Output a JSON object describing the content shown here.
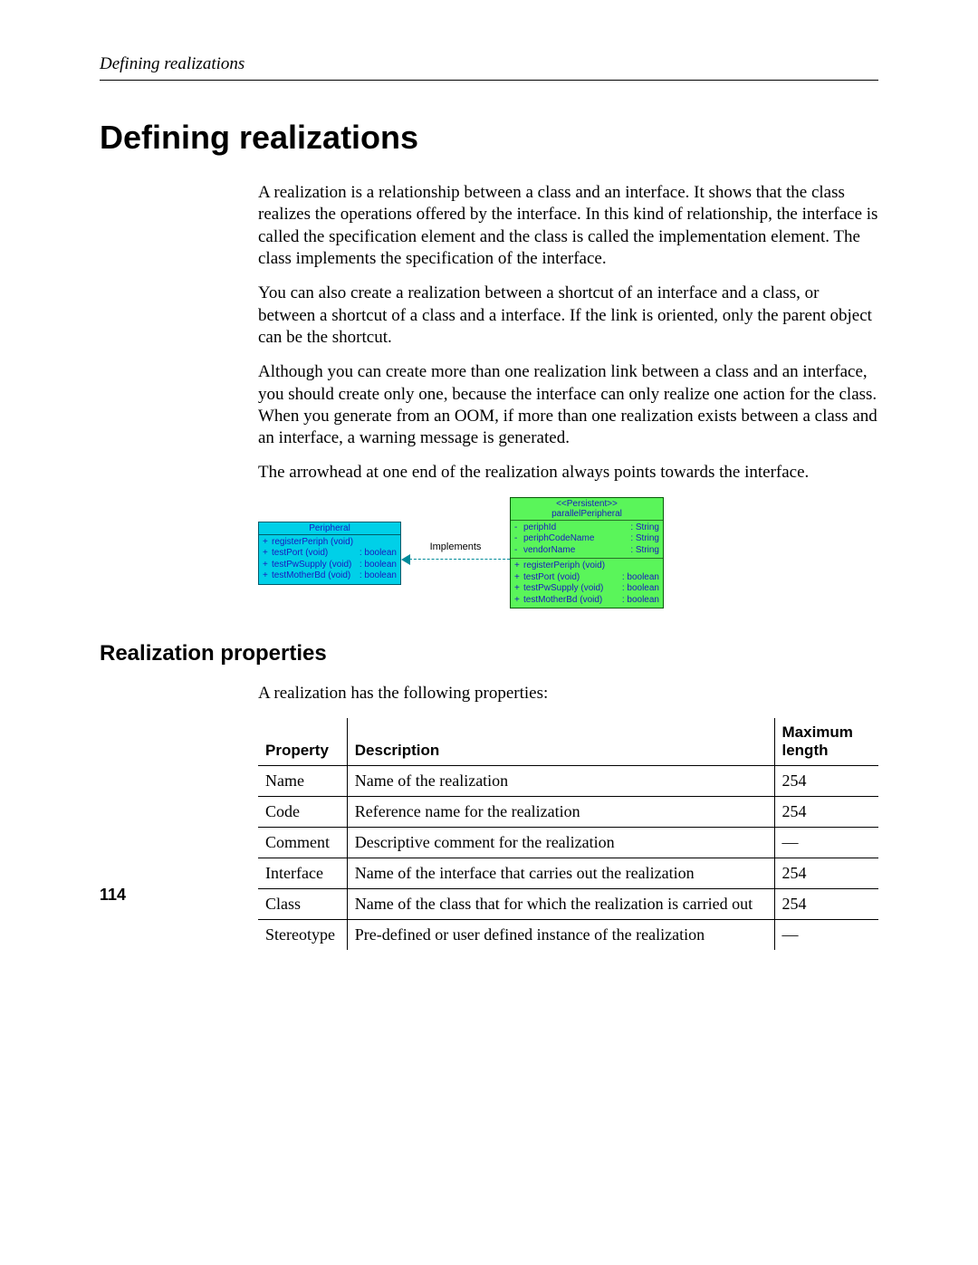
{
  "running_header": "Defining realizations",
  "title": "Defining realizations",
  "para1": "A realization is a relationship between a class and an interface. It shows that the class realizes the operations offered by the interface. In this kind of relationship, the interface is called the specification element and the class is called the implementation element. The class implements the specification of the interface.",
  "para2": "You can also create a realization between a shortcut of an interface and a class, or between a shortcut of a class and a interface. If the link is oriented, only the parent object can be the shortcut.",
  "para3": "Although you can create more than one realization link between a class and an interface, you should create only one, because the interface can only realize one action for the class. When you generate from an OOM, if more than one realization exists between a class and an interface, a warning message is generated.",
  "para4": "The arrowhead at one end of the realization always points towards the interface.",
  "uml": {
    "class_title": "Peripheral",
    "class_ops": [
      {
        "vis": "+",
        "sig": "registerPeriph (void)",
        "ret": ""
      },
      {
        "vis": "+",
        "sig": "testPort (void)",
        "ret": ": boolean"
      },
      {
        "vis": "+",
        "sig": "testPwSupply (void)",
        "ret": ": boolean"
      },
      {
        "vis": "+",
        "sig": "testMotherBd (void)",
        "ret": ": boolean"
      }
    ],
    "conn_label": "Implements",
    "iface_stereotype": "<<Persistent>>",
    "iface_title": "parallelPeripheral",
    "iface_attrs": [
      {
        "vis": "-",
        "sig": "periphId",
        "ret": ": String"
      },
      {
        "vis": "-",
        "sig": "periphCodeName",
        "ret": ": String"
      },
      {
        "vis": "-",
        "sig": "vendorName",
        "ret": ": String"
      }
    ],
    "iface_ops": [
      {
        "vis": "+",
        "sig": "registerPeriph (void)",
        "ret": ""
      },
      {
        "vis": "+",
        "sig": "testPort (void)",
        "ret": ": boolean"
      },
      {
        "vis": "+",
        "sig": "testPwSupply (void)",
        "ret": ": boolean"
      },
      {
        "vis": "+",
        "sig": "testMotherBd (void)",
        "ret": ": boolean"
      }
    ]
  },
  "section2_title": "Realization properties",
  "section2_intro": "A realization has the following properties:",
  "table": {
    "h1": "Property",
    "h2": "Description",
    "h3": "Maximum length",
    "rows": [
      {
        "p": "Name",
        "d": "Name of the realization",
        "m": "254"
      },
      {
        "p": "Code",
        "d": "Reference name for the realization",
        "m": "254"
      },
      {
        "p": "Comment",
        "d": "Descriptive comment for the realization",
        "m": "—"
      },
      {
        "p": "Interface",
        "d": "Name of the interface that carries out the realization",
        "m": "254"
      },
      {
        "p": "Class",
        "d": "Name of the class that for which the realization is carried out",
        "m": "254"
      },
      {
        "p": "Stereotype",
        "d": "Pre-defined or user defined instance of the realization",
        "m": "—"
      }
    ]
  },
  "page_number": "114"
}
